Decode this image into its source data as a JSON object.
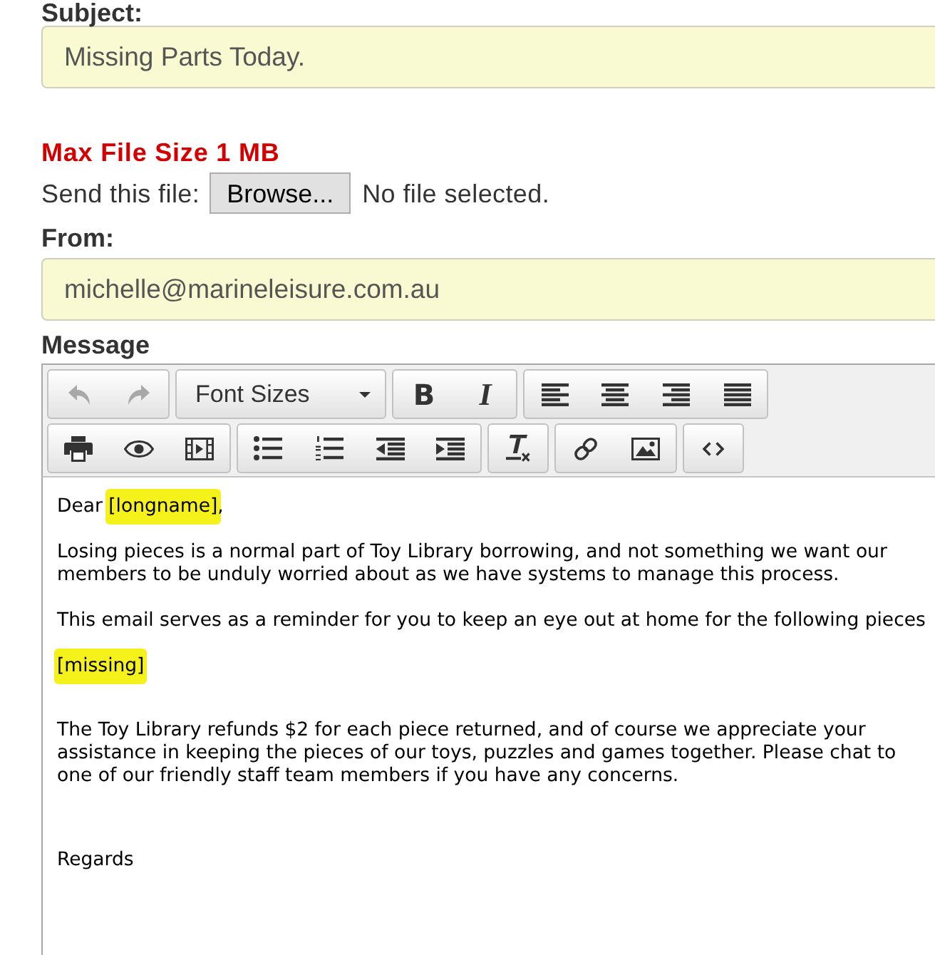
{
  "subject": {
    "label": "Subject:",
    "value": "Missing Parts Today."
  },
  "attachment": {
    "note": "Max File Size 1 MB",
    "label": "Send this file:",
    "button": "Browse...",
    "status": "No file selected."
  },
  "from": {
    "label": "From:",
    "value": "michelle@marineleisure.com.au"
  },
  "message": {
    "label": "Message",
    "toolbar": {
      "rows": [
        {
          "groups": [
            {
              "buttons": [
                {
                  "kind": "undo",
                  "disabled": true
                },
                {
                  "kind": "redo",
                  "disabled": true
                }
              ]
            },
            {
              "buttons": [
                {
                  "kind": "select",
                  "label": "Font Sizes",
                  "disabled": false
                }
              ]
            },
            {
              "buttons": [
                {
                  "kind": "bold",
                  "label": "B",
                  "disabled": false
                },
                {
                  "kind": "italic",
                  "label": "I",
                  "disabled": false
                }
              ]
            },
            {
              "buttons": [
                {
                  "kind": "alignleft",
                  "disabled": false
                },
                {
                  "kind": "aligncenter",
                  "disabled": false
                },
                {
                  "kind": "alignright",
                  "disabled": false
                },
                {
                  "kind": "justify",
                  "disabled": false
                }
              ]
            }
          ]
        },
        {
          "groups": [
            {
              "buttons": [
                {
                  "kind": "print",
                  "disabled": false
                },
                {
                  "kind": "preview",
                  "disabled": false
                },
                {
                  "kind": "media",
                  "disabled": false
                }
              ]
            },
            {
              "buttons": [
                {
                  "kind": "bullist",
                  "disabled": false
                },
                {
                  "kind": "numlist",
                  "disabled": false
                },
                {
                  "kind": "outdent",
                  "disabled": false
                },
                {
                  "kind": "indent",
                  "disabled": false
                }
              ]
            },
            {
              "buttons": [
                {
                  "kind": "removeformat",
                  "disabled": false
                }
              ]
            },
            {
              "buttons": [
                {
                  "kind": "link",
                  "disabled": false
                },
                {
                  "kind": "image",
                  "disabled": false
                }
              ]
            },
            {
              "buttons": [
                {
                  "kind": "code",
                  "disabled": false
                }
              ]
            }
          ]
        }
      ]
    },
    "paragraphs": [
      {
        "segments": [
          {
            "text": "Dear ",
            "highlighted": false
          },
          {
            "text": "[longname]",
            "highlighted": true
          },
          {
            "text": ",",
            "highlighted": false
          }
        ]
      },
      {
        "segments": [
          {
            "text": "Losing pieces is a normal part of Toy Library borrowing, and not something we want our members to be unduly worried about as we have systems to manage this process.",
            "highlighted": false
          }
        ]
      },
      {
        "segments": [
          {
            "text": "This email serves as a reminder for you to keep an eye out at home for the following pieces",
            "highlighted": false
          }
        ]
      },
      {
        "segments": [
          {
            "text": "[missing]",
            "highlighted": true
          }
        ]
      },
      {
        "segments": [
          {
            "text": "The Toy Library refunds $2 for each piece returned, and of course we appreciate your assistance in keeping the pieces of our toys, puzzles and games together. Please chat to one of our friendly staff team members if you have any concerns.",
            "highlighted": false
          }
        ]
      },
      {
        "segments": [
          {
            "text": "Regards",
            "highlighted": false
          }
        ]
      }
    ]
  }
}
